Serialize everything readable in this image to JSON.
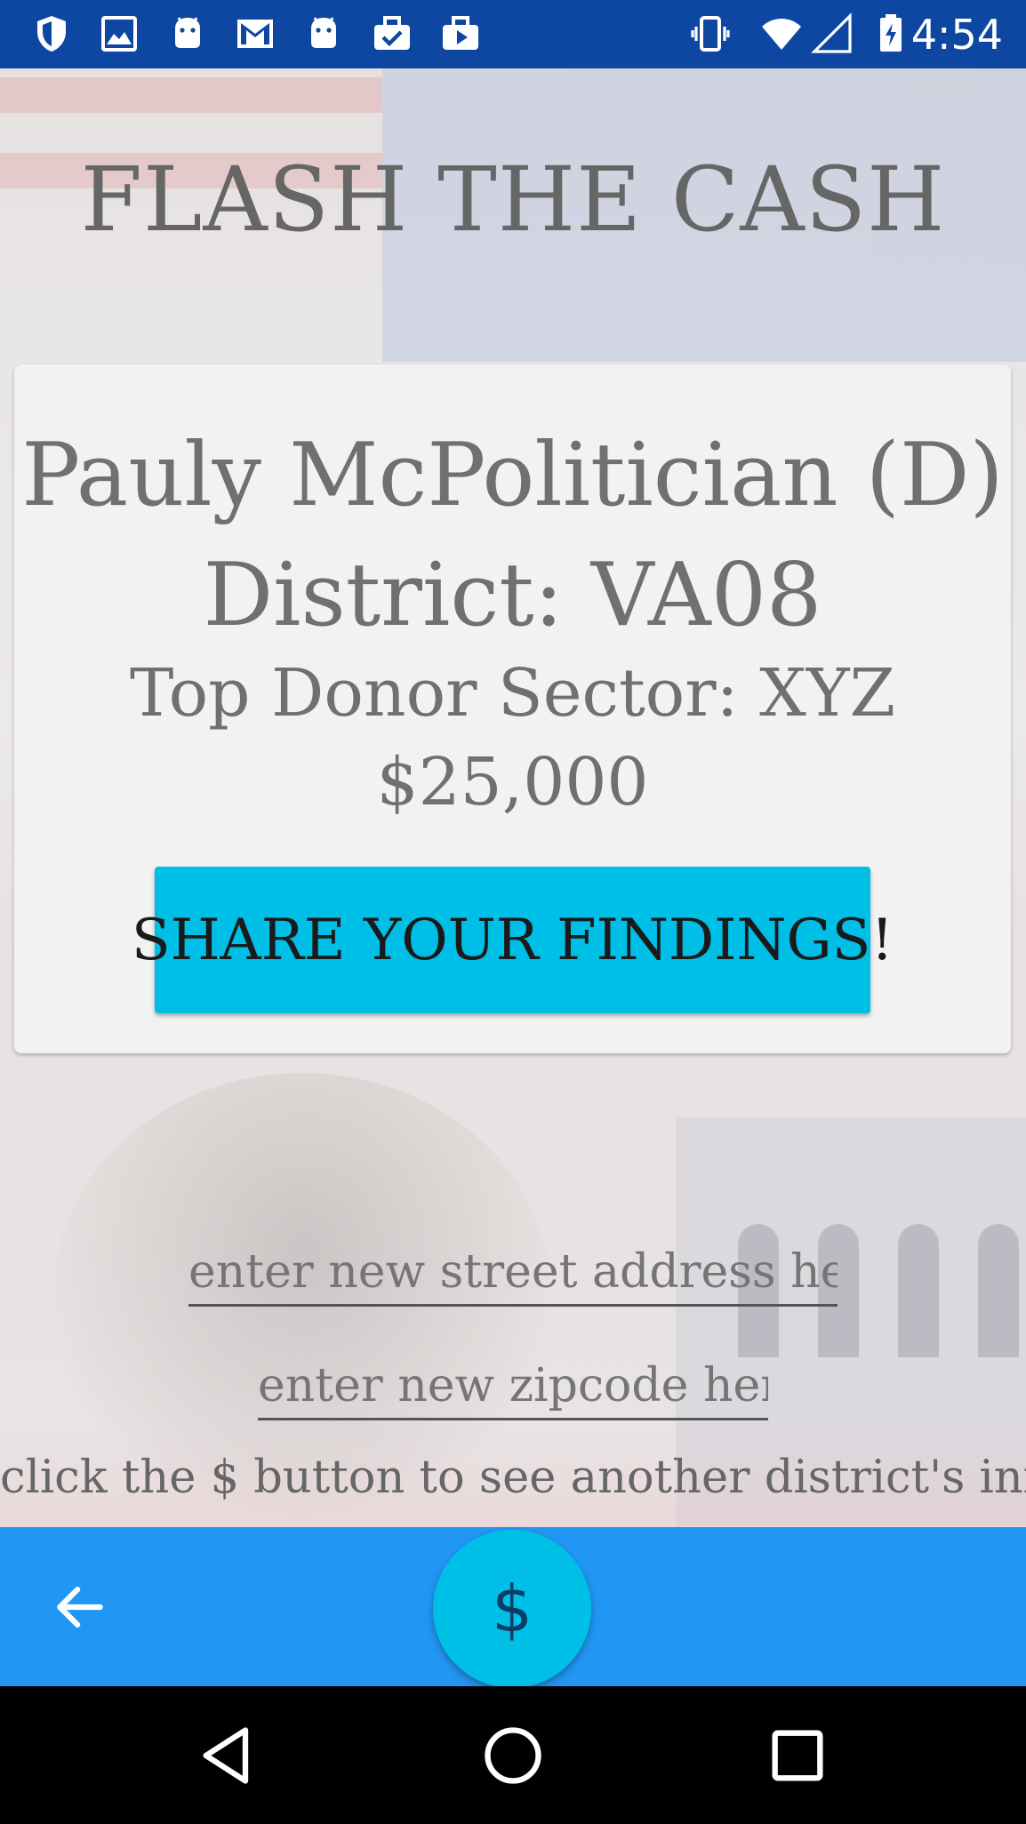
{
  "status_bar": {
    "time": "4:54",
    "left_icons": [
      "shield-icon",
      "image-icon",
      "android-icon",
      "gmail-icon",
      "android-icon",
      "briefcase-check-icon",
      "briefcase-play-icon"
    ],
    "right_icons": [
      "vibrate-icon",
      "wifi-icon",
      "signal-icon",
      "battery-charging-icon"
    ]
  },
  "app": {
    "title": "FLASH THE CASH"
  },
  "card": {
    "name": "Pauly McPolitician (D)",
    "district": "District: VA08",
    "sector": "Top Donor Sector: XYZ",
    "amount": "$25,000",
    "share_label": "SHARE YOUR FINDINGS!"
  },
  "inputs": {
    "street_placeholder": "enter new street address here",
    "zip_placeholder": "enter new zipcode here"
  },
  "hint": "click the $ button to see another district's info",
  "app_bar": {
    "back_icon": "arrow-left-icon",
    "fab_label": "$"
  },
  "nav_bar": {
    "icons": [
      "back-triangle-icon",
      "home-circle-icon",
      "recents-square-icon"
    ]
  },
  "colors": {
    "status_bar": "#0D47A1",
    "app_bar": "#2196F3",
    "accent": "#00BFE6",
    "card": "#F2F2F2"
  }
}
